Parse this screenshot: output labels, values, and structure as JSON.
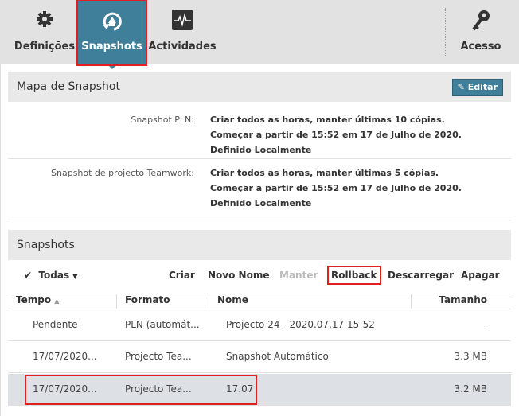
{
  "tabs": [
    {
      "label": "Definições",
      "icon": "gear-icon"
    },
    {
      "label": "Snapshots",
      "icon": "snapshot-icon",
      "active": true
    },
    {
      "label": "Actividades",
      "icon": "activity-icon"
    },
    {
      "label": "Acesso",
      "icon": "key-icon"
    }
  ],
  "map": {
    "title": "Mapa de Snapshot",
    "edit_label": "Editar",
    "rows": [
      {
        "label": "Snapshot PLN:",
        "lines": [
          "Criar todos as horas, manter últimas 10 cópias.",
          "Começar a partir de 15:52 em 17 de Julho de 2020.",
          "Definido Localmente"
        ]
      },
      {
        "label": "Snapshot de projecto Teamwork:",
        "lines": [
          "Criar todos as horas, manter últimas 5 cópias.",
          "Começar a partir de 15:52 em 17 de Julho de 2020.",
          "Definido Localmente"
        ]
      }
    ]
  },
  "snapshots": {
    "title": "Snapshots",
    "filter": "Todas",
    "actions": {
      "create": "Criar",
      "rename": "Novo Nome",
      "keep": "Manter",
      "rollback": "Rollback",
      "download": "Descarregar",
      "delete": "Apagar"
    },
    "columns": [
      "Tempo",
      "Formato",
      "Nome",
      "Tamanho"
    ],
    "rows": [
      {
        "time": "Pendente",
        "format": "PLN (automát...",
        "name": "Projecto 24 - 2020.07.17 15-52",
        "size": "-"
      },
      {
        "time": "17/07/2020...",
        "format": "Projecto Tea...",
        "name": "Snapshot Automático",
        "size": "3.3 MB"
      },
      {
        "time": "17/07/2020...",
        "format": "Projecto Tea...",
        "name": "17.07",
        "size": "3.2 MB",
        "selected": true
      }
    ]
  },
  "colors": {
    "accent": "#3f7f9a",
    "highlight": "#e02020"
  }
}
